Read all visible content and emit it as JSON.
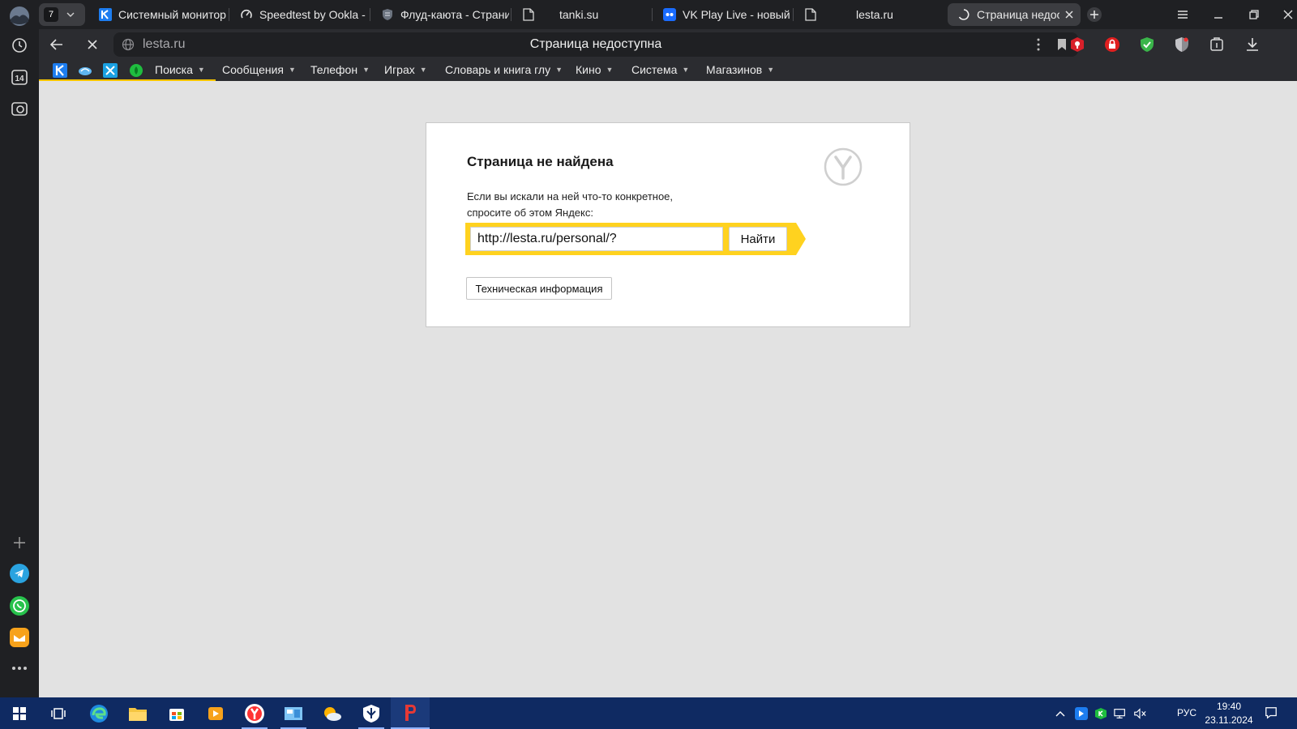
{
  "tabs": {
    "counter": "7",
    "items": [
      {
        "title": "Системный монитор"
      },
      {
        "title": "Speedtest by Ookla - T"
      },
      {
        "title": "Флуд-каюта - Страни"
      },
      {
        "title": "tanki.su"
      },
      {
        "title": "VK Play Live - новый г"
      },
      {
        "title": "lesta.ru"
      },
      {
        "title": "Страница недосту"
      }
    ]
  },
  "address": {
    "domain": "lesta.ru",
    "page_title": "Страница недоступна"
  },
  "bookmarks": [
    {
      "label": "Поиска"
    },
    {
      "label": "Сообщения"
    },
    {
      "label": "Телефон"
    },
    {
      "label": "Играх"
    },
    {
      "label": "Словарь и книга глу"
    },
    {
      "label": "Кино"
    },
    {
      "label": "Система"
    },
    {
      "label": "Магазинов"
    }
  ],
  "sidebar": {
    "calendar_day": "14"
  },
  "error_page": {
    "title": "Страница не найдена",
    "message_line1": "Если вы искали на ней что-то конкретное,",
    "message_line2": "спросите об этом Яндекс:",
    "search_value": "http://lesta.ru/personal/?",
    "search_button": "Найти",
    "tech_button": "Техническая информация"
  },
  "taskbar": {
    "language": "РУС",
    "time": "19:40",
    "date": "23.11.2024"
  },
  "colors": {
    "yellow": "#ffd21f",
    "taskbar": "#0f2a62",
    "content_bg": "#e2e2e2"
  }
}
